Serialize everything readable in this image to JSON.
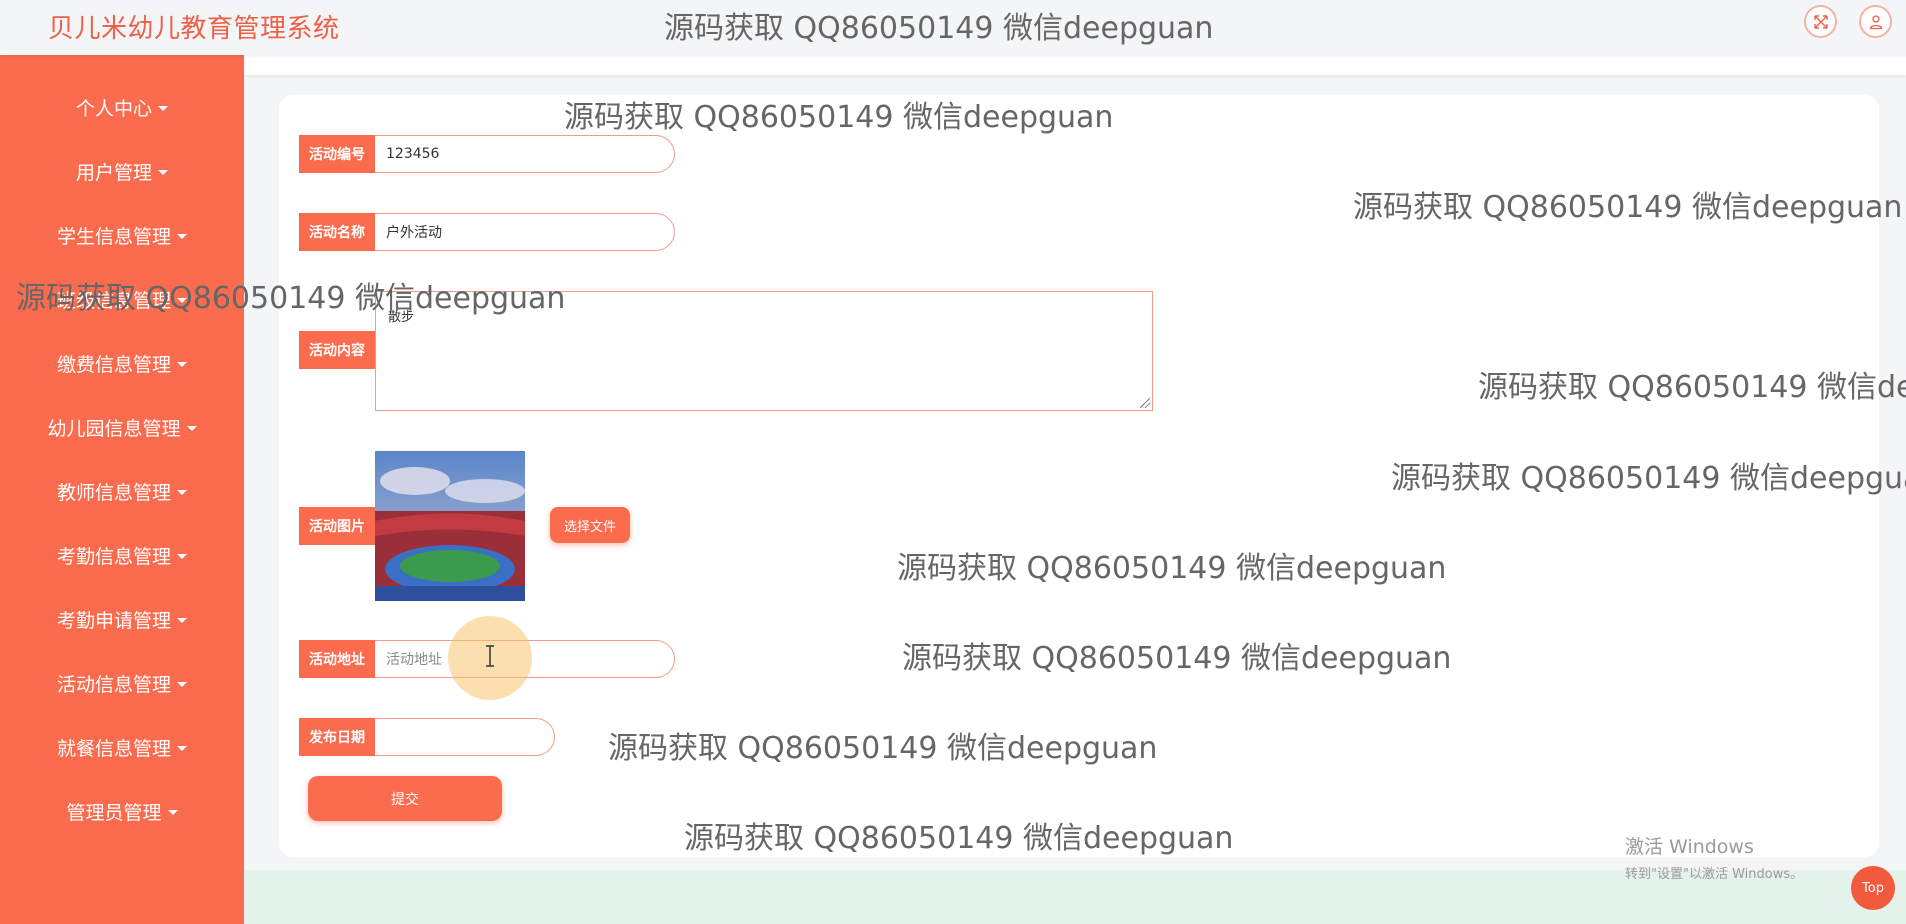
{
  "header": {
    "app_title": "贝儿米幼儿教育管理系统",
    "icons": [
      "fullscreen-icon",
      "user-icon"
    ]
  },
  "sidebar": {
    "items": [
      {
        "label": "个人中心"
      },
      {
        "label": "用户管理"
      },
      {
        "label": "学生信息管理"
      },
      {
        "label": "班级信息管理"
      },
      {
        "label": "缴费信息管理"
      },
      {
        "label": "幼儿园信息管理"
      },
      {
        "label": "教师信息管理"
      },
      {
        "label": "考勤信息管理"
      },
      {
        "label": "考勤申请管理"
      },
      {
        "label": "活动信息管理"
      },
      {
        "label": "就餐信息管理"
      },
      {
        "label": "管理员管理"
      }
    ]
  },
  "form": {
    "activity_no": {
      "label": "活动编号",
      "value": "123456"
    },
    "activity_name": {
      "label": "活动名称",
      "value": "户外活动"
    },
    "activity_content": {
      "label": "活动内容",
      "value": "散步"
    },
    "activity_image": {
      "label": "活动图片",
      "choose_file": "选择文件"
    },
    "activity_address": {
      "label": "活动地址",
      "placeholder": "活动地址",
      "value": ""
    },
    "publish_date": {
      "label": "发布日期",
      "value": ""
    },
    "submit": "提交"
  },
  "watermark": "源码获取 QQ86050149 微信deepguan",
  "watermark_truncated_a": "源码获取 QQ86050149 微信de",
  "watermark_truncated_b": "源码获取 QQ86050149 微信deepgua",
  "os_notice": {
    "line1": "激活 Windows",
    "line2": "转到\"设置\"以激活 Windows。"
  },
  "top_button": "Top",
  "colors": {
    "primary": "#fb6b4e",
    "title": "#ee6048",
    "field_border": "#f19a88",
    "background": "#f4f5f7"
  }
}
